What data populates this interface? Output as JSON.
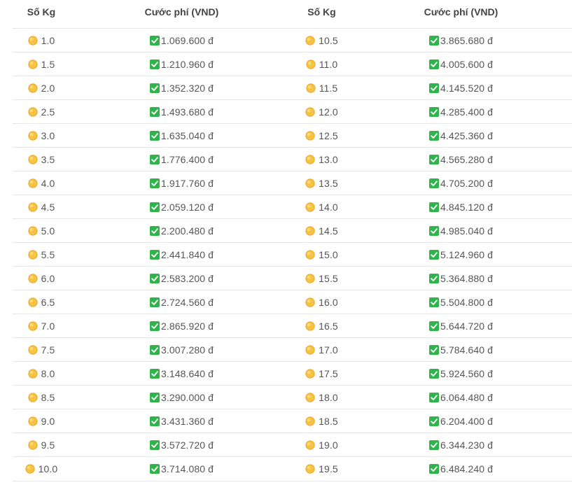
{
  "header": {
    "col1": "Số Kg",
    "col2": "Cước phí (VND)",
    "col3": "Số Kg",
    "col4": "Cước phí (VND)"
  },
  "colors": {
    "check": "#2fb34a",
    "sun": "#f6c343",
    "sun_rim": "#f0a020",
    "divider": "#e6e6e6"
  },
  "icons": {
    "weight": "sun-emoji-icon",
    "fee": "green-check-icon"
  },
  "rows": [
    {
      "kg1": "1.0",
      "fee1": "1.069.600 đ",
      "kg2": "10.5",
      "fee2": "3.865.680 đ"
    },
    {
      "kg1": "1.5",
      "fee1": "1.210.960 đ",
      "kg2": "11.0",
      "fee2": "4.005.600 đ"
    },
    {
      "kg1": "2.0",
      "fee1": "1.352.320 đ",
      "kg2": "11.5",
      "fee2": "4.145.520 đ"
    },
    {
      "kg1": "2.5",
      "fee1": "1.493.680 đ",
      "kg2": "12.0",
      "fee2": "4.285.400 đ"
    },
    {
      "kg1": "3.0",
      "fee1": "1.635.040 đ",
      "kg2": "12.5",
      "fee2": "4.425.360 đ"
    },
    {
      "kg1": "3.5",
      "fee1": "1.776.400 đ",
      "kg2": "13.0",
      "fee2": "4.565.280 đ"
    },
    {
      "kg1": "4.0",
      "fee1": "1.917.760 đ",
      "kg2": "13.5",
      "fee2": "4.705.200 đ"
    },
    {
      "kg1": "4.5",
      "fee1": "2.059.120 đ",
      "kg2": "14.0",
      "fee2": "4.845.120 đ"
    },
    {
      "kg1": "5.0",
      "fee1": "2.200.480 đ",
      "kg2": "14.5",
      "fee2": "4.985.040 đ"
    },
    {
      "kg1": "5.5",
      "fee1": "2.441.840 đ",
      "kg2": "15.0",
      "fee2": "5.124.960 đ"
    },
    {
      "kg1": "6.0",
      "fee1": "2.583.200 đ",
      "kg2": "15.5",
      "fee2": "5.364.880 đ"
    },
    {
      "kg1": "6.5",
      "fee1": "2.724.560 đ",
      "kg2": "16.0",
      "fee2": "5.504.800 đ"
    },
    {
      "kg1": "7.0",
      "fee1": "2.865.920 đ",
      "kg2": "16.5",
      "fee2": "5.644.720 đ"
    },
    {
      "kg1": "7.5",
      "fee1": "3.007.280 đ",
      "kg2": "17.0",
      "fee2": "5.784.640 đ"
    },
    {
      "kg1": "8.0",
      "fee1": "3.148.640 đ",
      "kg2": "17.5",
      "fee2": "5.924.560 đ"
    },
    {
      "kg1": "8.5",
      "fee1": "3.290.000 đ",
      "kg2": "18.0",
      "fee2": "6.064.480 đ"
    },
    {
      "kg1": "9.0",
      "fee1": "3.431.360 đ",
      "kg2": "18.5",
      "fee2": "6.204.400 đ"
    },
    {
      "kg1": "9.5",
      "fee1": "3.572.720 đ",
      "kg2": "19.0",
      "fee2": "6.344.230 đ"
    },
    {
      "kg1": "10.0",
      "fee1": "3.714.080 đ",
      "kg2": "19.5",
      "fee2": "6.484.240 đ"
    }
  ]
}
